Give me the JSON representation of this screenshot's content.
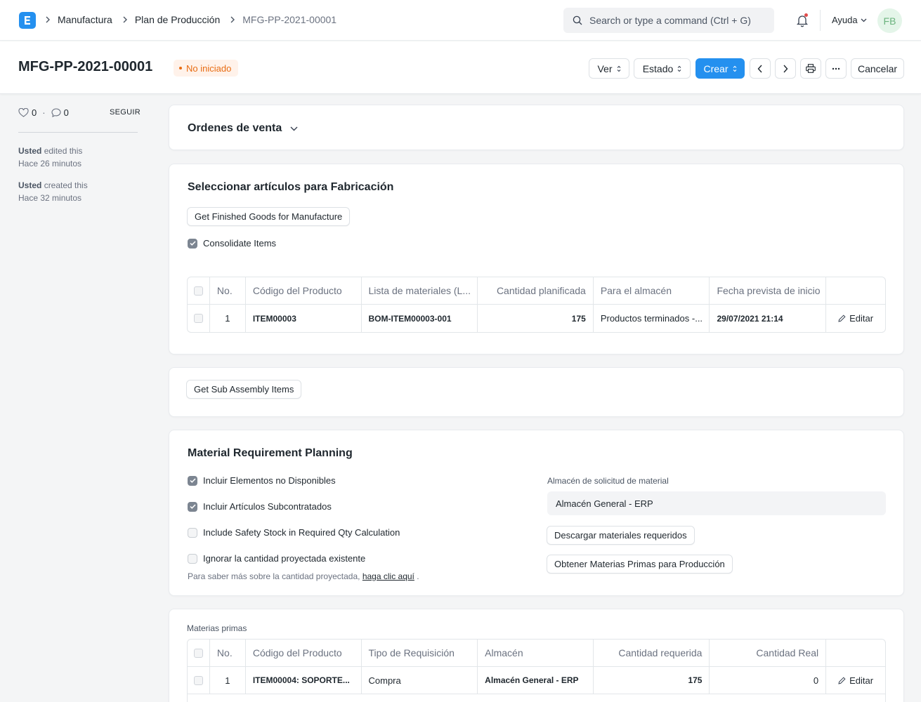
{
  "navbar": {
    "breadcrumbs": [
      "Manufactura",
      "Plan de Producción",
      "MFG-PP-2021-00001"
    ],
    "search_placeholder": "Search or type a command (Ctrl + G)",
    "help_label": "Ayuda",
    "avatar_initials": "FB"
  },
  "page": {
    "title": "MFG-PP-2021-00001",
    "status": "No iniciado",
    "status_color": "#e86c13",
    "actions": {
      "view": "Ver",
      "status": "Estado",
      "create": "Crear",
      "cancel": "Cancelar"
    }
  },
  "sidebar": {
    "likes": "0",
    "comments": "0",
    "follow": "SEGUIR",
    "activity": [
      {
        "user": "Usted",
        "action": "edited this",
        "time": "Hace 26 minutos"
      },
      {
        "user": "Usted",
        "action": "created this",
        "time": "Hace 32 minutos"
      }
    ]
  },
  "sales_orders": {
    "title": "Ordenes de venta"
  },
  "select_items": {
    "title": "Seleccionar artículos para Fabricación",
    "get_button": "Get Finished Goods for Manufacture",
    "consolidate_label": "Consolidate Items",
    "consolidate_checked": true,
    "columns": [
      "No.",
      "Código del Producto",
      "Lista de materiales (L...",
      "Cantidad planificada",
      "Para el almacén",
      "Fecha prevista de inicio"
    ],
    "rows": [
      {
        "no": "1",
        "code": "ITEM00003",
        "bom": "BOM-ITEM00003-001",
        "qty": "175",
        "warehouse": "Productos terminados -...",
        "start": "29/07/2021 21:14",
        "edit": "Editar"
      }
    ]
  },
  "sub_assembly": {
    "button": "Get Sub Assembly Items"
  },
  "mrp": {
    "title": "Material Requirement Planning",
    "checks": [
      {
        "label": "Incluir Elementos no Disponibles",
        "checked": true
      },
      {
        "label": "Incluir Artículos Subcontratados",
        "checked": true
      },
      {
        "label": "Include Safety Stock in Required Qty Calculation",
        "checked": false
      },
      {
        "label": "Ignorar la cantidad proyectada existente",
        "checked": false
      }
    ],
    "note_prefix": "Para saber más sobre la cantidad proyectada,",
    "note_link": "haga clic aquí",
    "note_suffix": ".",
    "warehouse_label": "Almacén de solicitud de material",
    "warehouse_value": "Almacén General - ERP",
    "download_button": "Descargar materiales requeridos",
    "raw_button": "Obtener Materias Primas para Producción"
  },
  "raw_materials": {
    "label": "Materias primas",
    "columns": [
      "No.",
      "Código del Producto",
      "Tipo de Requisición",
      "Almacén",
      "Cantidad requerida",
      "Cantidad Real"
    ],
    "rows": [
      {
        "no": "1",
        "code": "ITEM00004: SOPORTE...",
        "type": "Compra",
        "warehouse": "Almacén General - ERP",
        "required": "175",
        "actual": "0",
        "edit": "Editar"
      }
    ]
  }
}
